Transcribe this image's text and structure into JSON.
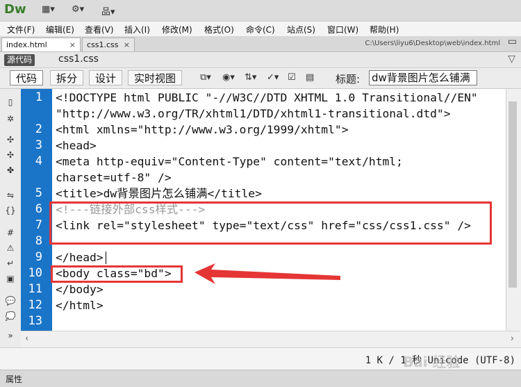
{
  "app": {
    "logo": "Dw"
  },
  "toolbar_top": {
    "icons": [
      "layout-icon",
      "gear-icon",
      "site-icon"
    ]
  },
  "menu": [
    "文件(F)",
    "编辑(E)",
    "查看(V)",
    "插入(I)",
    "修改(M)",
    "格式(O)",
    "命令(C)",
    "站点(S)",
    "窗口(W)",
    "帮助(H)"
  ],
  "tabs": [
    {
      "label": "index.html",
      "close": "×"
    },
    {
      "label": "css1.css",
      "close": "×"
    }
  ],
  "file_path": "C:\\Users\\liyu6\\Desktop\\web\\index.html",
  "related_files": {
    "source_label": "源代码",
    "file": "css1.css"
  },
  "view_buttons": [
    "代码",
    "拆分",
    "设计",
    "实时视图"
  ],
  "title_label": "标题:",
  "title_value": "dw背景图片怎么铺满",
  "line_numbers": [
    "1",
    "2",
    "3",
    "4",
    "5",
    "6",
    "7",
    "8",
    "9",
    "10",
    "11",
    "12",
    "13"
  ],
  "code_lines": [
    "<!DOCTYPE html PUBLIC \"-//W3C//DTD XHTML 1.0 Transitional//EN\"",
    "\"http://www.w3.org/TR/xhtml1/DTD/xhtml1-transitional.dtd\">",
    "<html xmlns=\"http://www.w3.org/1999/xhtml\">",
    "<head>",
    "<meta http-equiv=\"Content-Type\" content=\"text/html;",
    "charset=utf-8\" />",
    "<title>dw背景图片怎么铺满</title>",
    "<!---链接外部css样式--->",
    "<link rel=\"stylesheet\" type=\"text/css\" href=\"css/css1.css\" />",
    "",
    "</head>",
    "<body class=\"bd\">",
    "</body>",
    "</html>",
    ""
  ],
  "status": "1 K / 1 秒 Unicode (UTF-8)",
  "properties_label": "属性",
  "watermark": "Bai 经验",
  "colors": {
    "gutter": "#1a74c8",
    "annotation": "#e53535",
    "comment": "#999999"
  }
}
